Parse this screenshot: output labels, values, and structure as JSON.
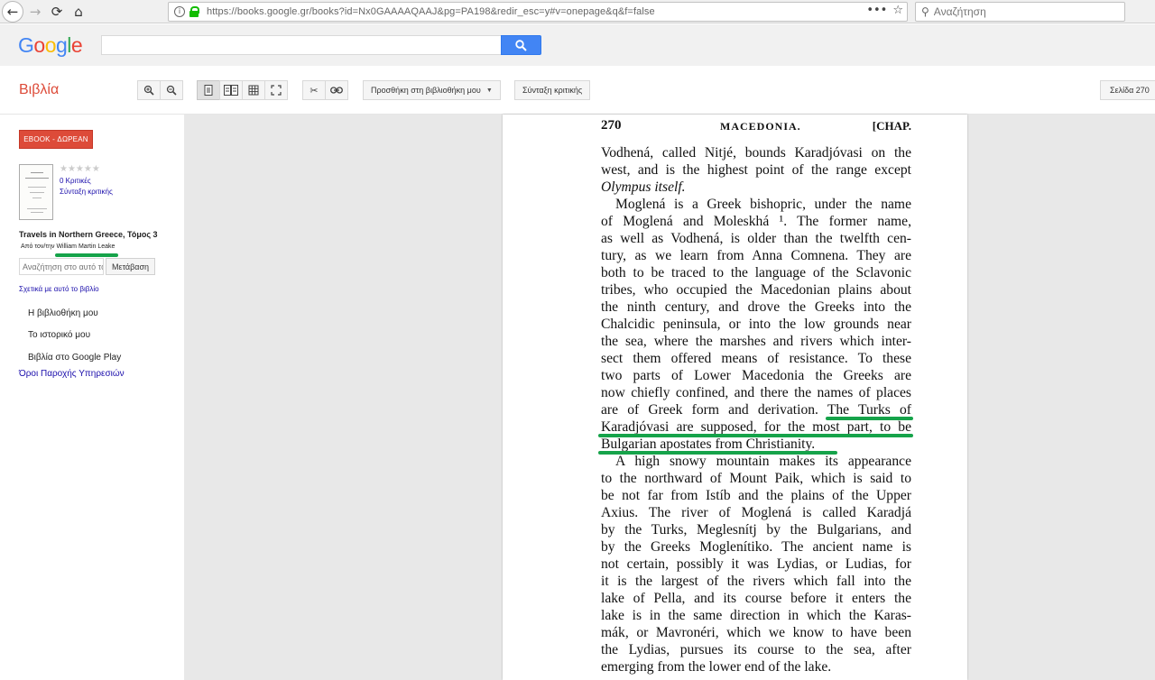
{
  "browser": {
    "url": "https://books.google.gr/books?id=Nx0GAAAAQAAJ&pg=PA198&redir_esc=y#v=onepage&q&f=false",
    "search_placeholder": "Αναζήτηση",
    "icons": {
      "back": "arrow-left-icon",
      "forward": "arrow-right-icon",
      "reload": "reload-icon",
      "home": "home-icon",
      "more": "more-icon",
      "bookmark": "star-icon",
      "search": "search-icon"
    }
  },
  "google": {
    "logo_letters": [
      "G",
      "o",
      "o",
      "g",
      "l",
      "e"
    ],
    "search_value": ""
  },
  "toolbar": {
    "title": "Βιβλία",
    "add_to_library": "Προσθήκη στη βιβλιοθήκη μου",
    "write_review": "Σύνταξη κριτικής",
    "page_select": "Σελίδα 270"
  },
  "sidebar": {
    "ebook_button": "EBOOK - ΔΩΡΕΑΝ",
    "stars": "★★★★★",
    "reviews_link": "0 Κριτικές",
    "write_review_link": "Σύνταξη κριτικής",
    "book_title": "Travels in Northern Greece, Τόμος 3",
    "author_prefix": "Από τον/την",
    "author_name": "William Martin Leake",
    "search_placeholder": "Αναζήτηση στο αυτό το βιβλίο",
    "go_button": "Μετάβαση",
    "about_link": "Σχετικά με αυτό το βιβλίο",
    "items": [
      "Η βιβλιοθήκη μου",
      "Το ιστορικό μου",
      "Βιβλία στο Google Play"
    ],
    "terms_link": "Όροι Παροχής Υπηρεσιών"
  },
  "page": {
    "number": "270",
    "running_head": "MACEDONIA.",
    "chapter": "[CHAP.",
    "lines": [
      "Vodhená, called Nitjé, bounds Karadjóvasi on the",
      "west, and is the highest point of the range except",
      "Olympus itself.",
      "Moglená is a Greek bishopric, under the name",
      "of Moglená and Moleskhá ¹. The former name,",
      "as well as Vodhená, is older than the twelfth cen-",
      "tury, as we learn from Anna Comnena. They are",
      "both to be traced to the language of the Sclavonic",
      "tribes, who occupied the Macedonian plains about",
      "the ninth century, and drove the Greeks into the",
      "Chalcidic peninsula, or into the low grounds near",
      "the sea, where the marshes and rivers which inter-",
      "sect them offered means of resistance. To these",
      "two parts of Lower Macedonia the Greeks are",
      "now chiefly confined, and there the names of places",
      "are of Greek form and derivation. The Turks of",
      "Karadjóvasi are supposed, for the most part, to be",
      "Bulgarian apostates from Christianity.",
      "A high snowy mountain makes its appearance",
      "to the northward of Mount Paik, which is said to",
      "be not far from Istíb and the plains of the Upper",
      "Axius. The river of Moglená is called Karadjá",
      "by the Turks, Meglesnítj by the Bulgarians, and",
      "by the Greeks Moglenítiko. The ancient name is",
      "not certain, possibly it was Lydias, or Ludias, for",
      "it is the largest of the rivers which fall into the",
      "lake of Pella, and its course before it enters the",
      "lake is in the same direction in which the Karas-",
      "mák, or Mavronéri, which we know to have been",
      "the Lydias, pursues its course to the sea, after",
      "emerging from the lower end of the lake."
    ]
  },
  "colors": {
    "accent_red": "#dd4b39",
    "link_blue": "#1a0dab",
    "google_blue": "#4285f4",
    "highlight_green": "#16a34a"
  }
}
